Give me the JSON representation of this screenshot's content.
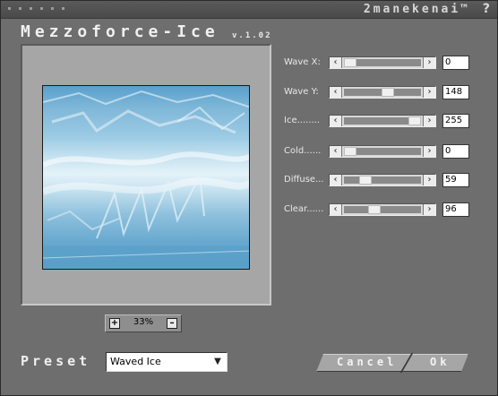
{
  "header": {
    "brand": "2manekenai™",
    "help": "?",
    "app_title": "Mezzoforce-Ice",
    "version": "v.1.02"
  },
  "preview": {
    "zoom": {
      "plus": "+",
      "value": "33%",
      "minus": "–"
    }
  },
  "params": [
    {
      "label": "Wave X:",
      "value": "0",
      "level": 0
    },
    {
      "label": "Wave Y:",
      "value": "148",
      "level": 148
    },
    {
      "label": "Ice........",
      "value": "255",
      "level": 255
    },
    {
      "label": "Cold......",
      "value": "0",
      "level": 0
    },
    {
      "label": "Diffuse...",
      "value": "59",
      "level": 59
    },
    {
      "label": "Clear......",
      "value": "96",
      "level": 96
    }
  ],
  "preset": {
    "label": "Preset",
    "selected": "Waved Ice",
    "arrow": "▼"
  },
  "buttons": {
    "cancel": "Cancel",
    "ok": "Ok"
  },
  "icons": {
    "left": "‹",
    "right": "›"
  }
}
